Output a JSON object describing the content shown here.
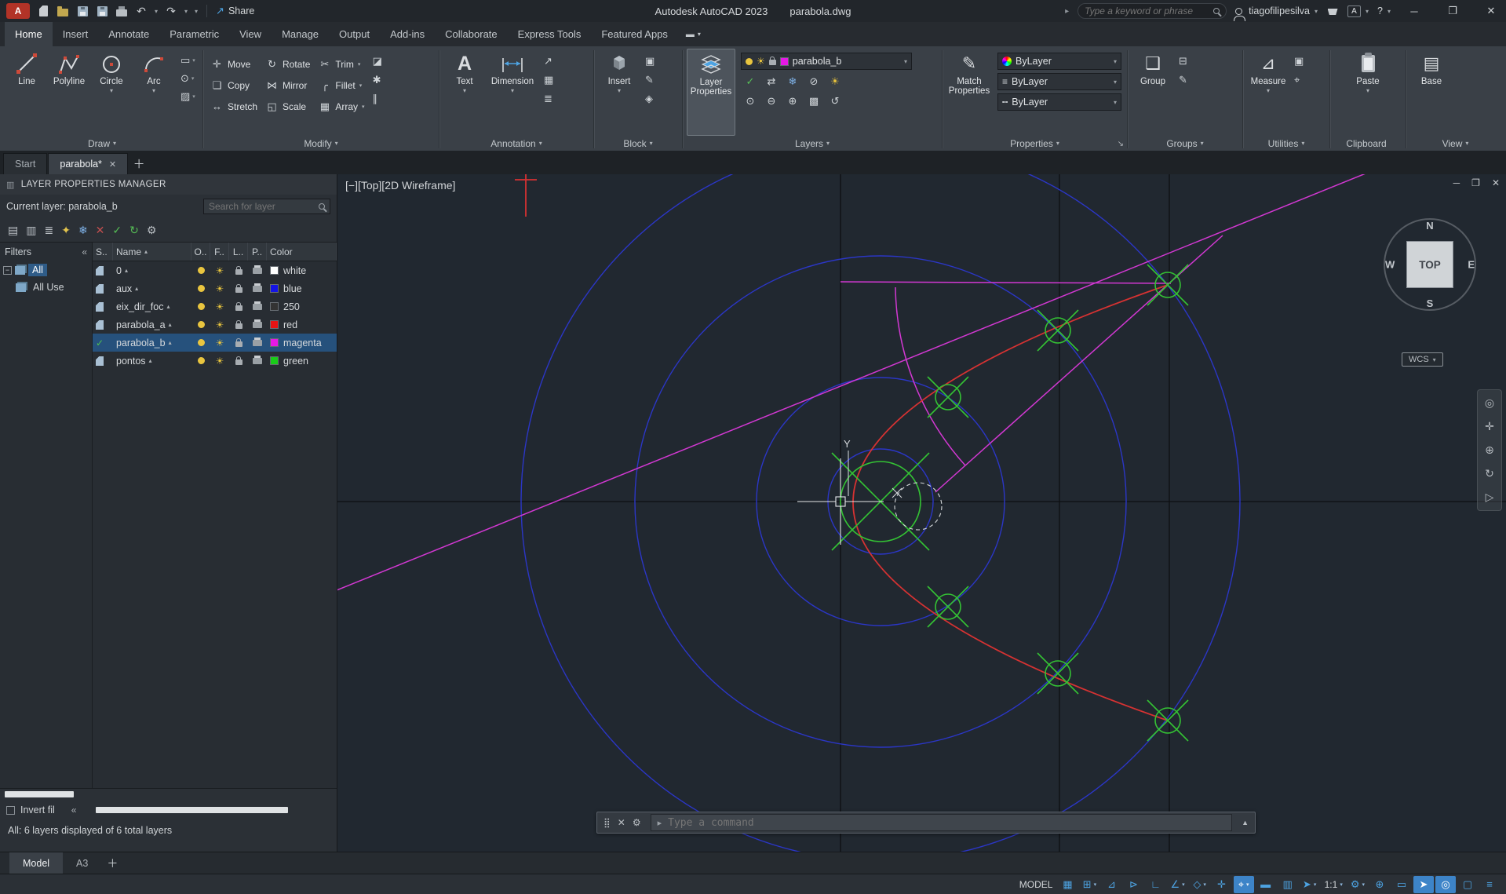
{
  "titlebar": {
    "app_title": "Autodesk AutoCAD 2023",
    "doc_title": "parabola.dwg",
    "share_label": "Share",
    "search_placeholder": "Type a keyword or phrase",
    "user_name": "tiagofilipesilva",
    "help_label": "?"
  },
  "ribbon_tabs": [
    {
      "label": "Home",
      "name": "tab-home",
      "active": true
    },
    {
      "label": "Insert",
      "name": "tab-insert"
    },
    {
      "label": "Annotate",
      "name": "tab-annotate"
    },
    {
      "label": "Parametric",
      "name": "tab-parametric"
    },
    {
      "label": "View",
      "name": "tab-view"
    },
    {
      "label": "Manage",
      "name": "tab-manage"
    },
    {
      "label": "Output",
      "name": "tab-output"
    },
    {
      "label": "Add-ins",
      "name": "tab-add-ins"
    },
    {
      "label": "Collaborate",
      "name": "tab-collaborate"
    },
    {
      "label": "Express Tools",
      "name": "tab-express-tools"
    },
    {
      "label": "Featured Apps",
      "name": "tab-featured-apps"
    }
  ],
  "panels": {
    "draw": {
      "label": "Draw",
      "line": "Line",
      "polyline": "Polyline",
      "circle": "Circle",
      "arc": "Arc"
    },
    "modify": {
      "label": "Modify",
      "buttons": [
        {
          "glyph": "✛",
          "label": "Move",
          "name": "move-button"
        },
        {
          "glyph": "❏",
          "label": "Copy",
          "name": "copy-button"
        },
        {
          "glyph": "↔",
          "label": "Stretch",
          "name": "stretch-button"
        },
        {
          "glyph": "↻",
          "label": "Rotate",
          "name": "rotate-button"
        },
        {
          "glyph": "⋈",
          "label": "Mirror",
          "name": "mirror-button"
        },
        {
          "glyph": "◱",
          "label": "Scale",
          "name": "scale-button"
        },
        {
          "glyph": "✂",
          "label": "Trim",
          "caret": "▾",
          "name": "trim-button"
        },
        {
          "glyph": "╭",
          "label": "Fillet",
          "caret": "▾",
          "name": "fillet-button"
        },
        {
          "glyph": "▦",
          "label": "Array",
          "caret": "▾",
          "name": "array-button"
        }
      ],
      "extra": [
        {
          "glyph": "◪",
          "name": "erase-button"
        },
        {
          "glyph": "✱",
          "name": "explode-button"
        },
        {
          "glyph": "∥",
          "name": "offset-button"
        }
      ]
    },
    "annotation": {
      "label": "Annotation",
      "text": "Text",
      "dimension": "Dimension",
      "extra": [
        {
          "glyph": "↗",
          "name": "leader-button"
        },
        {
          "glyph": "▦",
          "name": "table-button"
        },
        {
          "glyph": "≣",
          "name": "text-style-button"
        }
      ]
    },
    "block": {
      "label": "Block",
      "insert": "Insert",
      "extra": [
        {
          "glyph": "▣",
          "name": "create-block-button"
        },
        {
          "glyph": "✎",
          "name": "edit-block-button"
        },
        {
          "glyph": "◈",
          "name": "define-attributes-button"
        }
      ]
    },
    "layers": {
      "label": "Layers",
      "layer_properties": "Layer Properties",
      "combo_value": "parabola_b",
      "combo_color": "#e619e6",
      "row1": [
        {
          "glyph": "✓",
          "color": "#57c057",
          "name": "make-current-button"
        },
        {
          "glyph": "⇄",
          "name": "match-layer-button"
        },
        {
          "glyph": "❄",
          "color": "#7fb2e8",
          "name": "freeze-layer-button"
        },
        {
          "glyph": "⊘",
          "name": "off-layer-button"
        },
        {
          "glyph": "☀",
          "color": "#e8c33c",
          "name": "on-layer-button"
        }
      ],
      "row2": [
        {
          "glyph": "⊙",
          "name": "isolate-layer-button"
        },
        {
          "glyph": "⊖",
          "name": "unisolate-layer-button"
        },
        {
          "glyph": "⊕",
          "name": "lock-layer-button"
        },
        {
          "glyph": "▩",
          "name": "unlock-layer-button"
        },
        {
          "glyph": "↺",
          "name": "previous-layer-button"
        }
      ]
    },
    "properties": {
      "label": "Properties",
      "match": "Match Properties",
      "color_value": "ByLayer",
      "lineweight_value": "ByLayer",
      "linetype_value": "ByLayer"
    },
    "groups": {
      "label": "Groups",
      "group": "Group",
      "extra": [
        {
          "glyph": "⊟",
          "name": "ungroup-button"
        },
        {
          "glyph": "✎",
          "name": "group-edit-button"
        }
      ]
    },
    "utilities": {
      "label": "Utilities",
      "measure": "Measure",
      "extra": [
        {
          "glyph": "▣",
          "name": "quick-select-button"
        },
        {
          "glyph": "⌖",
          "name": "id-point-button"
        }
      ]
    },
    "clipboard": {
      "label": "Clipboard",
      "paste": "Paste"
    },
    "view": {
      "label": "View",
      "base": "Base"
    }
  },
  "file_tabs": {
    "start": "Start",
    "doc": "parabola*"
  },
  "layer_manager": {
    "title": "LAYER PROPERTIES MANAGER",
    "current_layer": "Current layer: parabola_b",
    "search_placeholder": "Search for layer",
    "filters_label": "Filters",
    "tree": [
      {
        "label": "All",
        "name": "filter-all",
        "active": true
      },
      {
        "label": "All Use",
        "name": "filter-all-used"
      }
    ],
    "columns": {
      "s": "S..",
      "name": "Name",
      "o": "O..",
      "f": "F..",
      "l": "L..",
      "p": "P..",
      "color": "Color"
    },
    "layers": [
      {
        "name": "0",
        "color_name": "white",
        "color": "#ffffff"
      },
      {
        "name": "aux",
        "color_name": "blue",
        "color": "#1414e6"
      },
      {
        "name": "eix_dir_foc",
        "color_name": "250",
        "color": "#333333"
      },
      {
        "name": "parabola_a",
        "color_name": "red",
        "color": "#e61414"
      },
      {
        "name": "parabola_b",
        "color_name": "magenta",
        "color": "#e619e6",
        "selected": true,
        "current": true
      },
      {
        "name": "pontos",
        "color_name": "green",
        "color": "#19cc19"
      }
    ],
    "toolbar": [
      {
        "glyph": "▤",
        "name": "new-property-filter-icon"
      },
      {
        "glyph": "▥",
        "name": "new-group-filter-icon"
      },
      {
        "glyph": "≣",
        "name": "layer-states-manager-icon"
      },
      {
        "glyph": "✦",
        "name": "new-layer-icon",
        "color": "#e3c44d"
      },
      {
        "glyph": "❄",
        "name": "new-vp-frozen-layer-icon",
        "color": "#7fb2e8"
      },
      {
        "glyph": "✕",
        "name": "delete-layer-icon",
        "color": "#c24f4f"
      },
      {
        "glyph": "✓",
        "name": "set-current-layer-icon",
        "color": "#55bd55"
      },
      {
        "glyph": "↻",
        "name": "refresh-icon",
        "color": "#55bd55"
      },
      {
        "glyph": "⚙",
        "name": "settings-gear-icon"
      }
    ],
    "invert_label": "Invert fil",
    "status": "All: 6 layers displayed of 6 total layers"
  },
  "viewport": {
    "label": "[−][Top][2D Wireframe]",
    "y_axis": "Y",
    "viewcube": {
      "n": "N",
      "w": "W",
      "e": "E",
      "s": "S",
      "top": "TOP",
      "wcs": "WCS"
    }
  },
  "command": {
    "placeholder": "Type a command"
  },
  "model_tabs": {
    "model": "Model",
    "a3": "A3"
  },
  "navbar": [
    {
      "glyph": "◎",
      "name": "navigation-wheel-icon"
    },
    {
      "glyph": "✛",
      "name": "pan-icon"
    },
    {
      "glyph": "⊕",
      "name": "zoom-icon"
    },
    {
      "glyph": "↻",
      "name": "orbit-icon"
    },
    {
      "glyph": "▷",
      "name": "show-motion-icon"
    }
  ],
  "status_bar": {
    "icons": [
      {
        "label": "MODEL",
        "name": "model-space-toggle"
      },
      {
        "glyph": "▦",
        "name": "grid-display-toggle"
      },
      {
        "glyph": "⊞",
        "caret": "▾",
        "name": "snap-mode-toggle"
      },
      {
        "glyph": "⊿",
        "name": "infer-constraints-toggle"
      },
      {
        "glyph": "⊳",
        "name": "dynamic-input-toggle"
      },
      {
        "glyph": "∟",
        "name": "ortho-mode-toggle"
      },
      {
        "glyph": "∠",
        "caret": "▾",
        "name": "polar-tracking-toggle"
      },
      {
        "glyph": "◇",
        "caret": "▾",
        "name": "isometric-drafting-toggle"
      },
      {
        "glyph": "✛",
        "name": "osnap-tracking-toggle"
      },
      {
        "glyph": "⌖",
        "caret": "▾",
        "name": "object-snap-toggle",
        "active": true
      },
      {
        "glyph": "▬",
        "name": "lineweight-toggle"
      },
      {
        "glyph": "▥",
        "name": "transparency-toggle"
      },
      {
        "glyph": "➤",
        "caret": "▾",
        "name": "selection-cycling-toggle"
      },
      {
        "label": "1:1",
        "caret": "▾",
        "name": "annotation-scale-button"
      },
      {
        "glyph": "⚙",
        "caret": "▾",
        "name": "workspace-switching-button"
      },
      {
        "glyph": "⊕",
        "name": "annotation-monitor-toggle"
      },
      {
        "glyph": "▭",
        "name": "units-button"
      },
      {
        "glyph": "➤",
        "name": "graphics-performance-toggle",
        "active": true
      },
      {
        "glyph": "◎",
        "name": "isolate-objects-button",
        "active": true
      },
      {
        "glyph": "▢",
        "name": "clean-screen-toggle"
      },
      {
        "glyph": "≡",
        "name": "customization-menu-button"
      }
    ]
  }
}
